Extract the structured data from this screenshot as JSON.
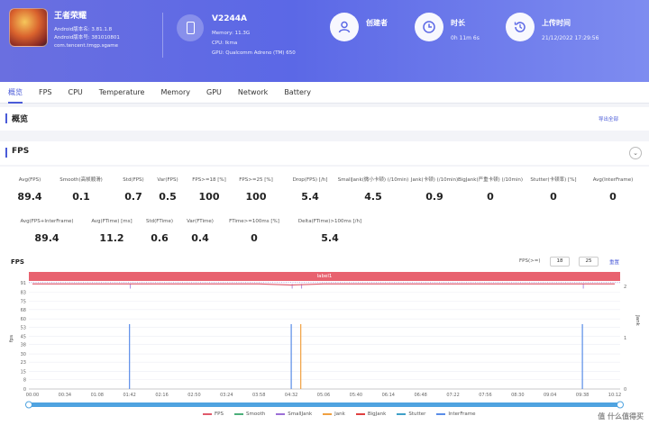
{
  "app": {
    "name": "王者荣耀",
    "lines": [
      "Android版本名: 3.81.1.8",
      "Android版本号: 381010801",
      "com.tencent.tmgp.sgame"
    ]
  },
  "device": {
    "name": "V2244A",
    "lines": [
      "Memory: 11.3G",
      "CPU: lkma",
      "GPU: Qualcomm Adreno (TM) 650"
    ]
  },
  "stats": {
    "creator_label": "创建者",
    "creator_value": "",
    "duration_label": "时长",
    "duration_value": "0h 11m 6s",
    "upload_label": "上传时间",
    "upload_value": "21/12/2022 17:29:56"
  },
  "header_link": "",
  "note": "",
  "tabs": [
    "概览",
    "FPS",
    "CPU",
    "Temperature",
    "Memory",
    "GPU",
    "Network",
    "Battery"
  ],
  "overview": {
    "title": "概览",
    "export_label": "导出全部"
  },
  "fps_section": {
    "title": "FPS",
    "metrics_row1": [
      {
        "label": "Avg(FPS)",
        "value": "89.4"
      },
      {
        "label": "Smooth(高帧顺滑)",
        "value": "0.1"
      },
      {
        "label": "Std(FPS)",
        "value": "0.7"
      },
      {
        "label": "Var(FPS)",
        "value": "0.5"
      },
      {
        "label": "FPS>=18 [%]",
        "value": "100"
      },
      {
        "label": "FPS>=25 [%]",
        "value": "100"
      },
      {
        "label": "Drop(FPS) [/h]",
        "value": "5.4"
      },
      {
        "label": "SmallJank(微小卡顿) (/10min)",
        "value": "4.5"
      },
      {
        "label": "Jank(卡顿) (/10min)",
        "value": "0.9"
      },
      {
        "label": "BigJank(严重卡顿) (/10min)",
        "value": "0"
      },
      {
        "label": "Stutter(卡顿率) [%]",
        "value": "0"
      },
      {
        "label": "Avg(InterFrame)",
        "value": "0"
      }
    ],
    "metrics_row2": [
      {
        "label": "Avg(FPS+InterFrame)",
        "value": "89.4"
      },
      {
        "label": "Avg(FTime) [ms]",
        "value": "11.2"
      },
      {
        "label": "Std(FTime)",
        "value": "0.6"
      },
      {
        "label": "Var(FTime)",
        "value": "0.4"
      },
      {
        "label": "FTime>=100ms [%]",
        "value": "0"
      },
      {
        "label": "Delta(FTime)>100ms [/h]",
        "value": "5.4"
      }
    ]
  },
  "chart_header": {
    "title": "FPS",
    "threshold_label": "FPS(>=)",
    "threshold_1": "18",
    "threshold_2": "25",
    "reset_label": "重置",
    "label_bar": "label1"
  },
  "chart_data": {
    "type": "line",
    "left_axis_label": "fps",
    "right_axis_label": "Jank",
    "y_ticks": [
      0,
      8,
      15,
      23,
      30,
      38,
      45,
      53,
      60,
      68,
      75,
      83,
      91,
      90
    ],
    "y_range": [
      0,
      91
    ],
    "right_ticks": [
      0,
      1,
      2
    ],
    "x_ticks": [
      "00:00",
      "00:34",
      "01:08",
      "01:42",
      "02:16",
      "02:50",
      "03:24",
      "03:58",
      "04:32",
      "05:06",
      "05:40",
      "06:14",
      "06:48",
      "07:22",
      "07:56",
      "08:30",
      "09:04",
      "09:38",
      "10:12"
    ],
    "series": [
      {
        "name": "FPS",
        "color": "#e05a6b",
        "values": [
          90,
          90,
          90,
          90,
          90,
          90,
          90,
          90,
          89,
          90,
          90,
          90,
          90,
          90,
          90,
          90,
          90,
          90,
          90
        ]
      },
      {
        "name": "Smooth",
        "color": "#4caf7a"
      },
      {
        "name": "SmallJank",
        "color": "#9c6fd6"
      },
      {
        "name": "Jank",
        "color": "#f0a040"
      },
      {
        "name": "BigJank",
        "color": "#e04040"
      },
      {
        "name": "Stutter",
        "color": "#3fa0c8"
      },
      {
        "name": "InterFrame",
        "color": "#5a8de8"
      }
    ],
    "jank_spikes_x": [
      "01:42",
      "04:32",
      "04:42",
      "09:38"
    ],
    "grid": true
  },
  "watermark": "值 什么值得买"
}
